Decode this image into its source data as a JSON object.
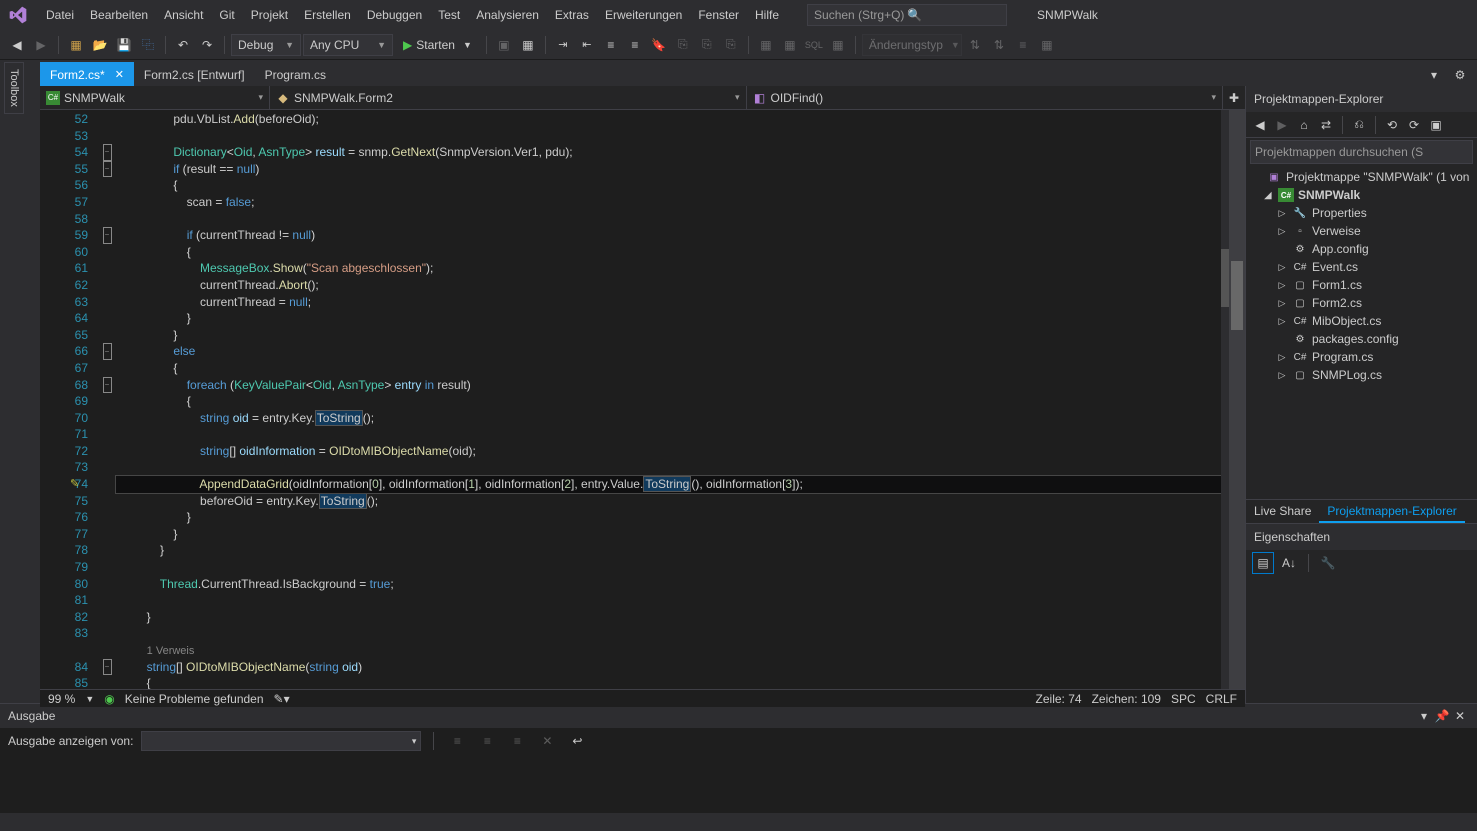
{
  "menubar": {
    "items": [
      "Datei",
      "Bearbeiten",
      "Ansicht",
      "Git",
      "Projekt",
      "Erstellen",
      "Debuggen",
      "Test",
      "Analysieren",
      "Extras",
      "Erweiterungen",
      "Fenster",
      "Hilfe"
    ]
  },
  "search": {
    "placeholder": "Suchen (Strg+Q)"
  },
  "solution_name": "SNMPWalk",
  "toolbar": {
    "config": "Debug",
    "platform": "Any CPU",
    "start": "Starten",
    "changes": "Änderungstyp"
  },
  "tabs": [
    {
      "label": "Form2.cs",
      "active": true,
      "dirty": true
    },
    {
      "label": "Form2.cs [Entwurf]",
      "active": false
    },
    {
      "label": "Program.cs",
      "active": false
    }
  ],
  "toolbox_label": "Toolbox",
  "navbar": {
    "project": "SNMPWalk",
    "class": "SNMPWalk.Form2",
    "member": "OIDFind()"
  },
  "code": {
    "first_line": 52,
    "lines": [
      {
        "n": 52,
        "html": "                pdu<span class='pl'>.</span>VbList<span class='pl'>.</span><span class='fn'>Add</span><span class='pl'>(</span>beforeOid<span class='pl'>);</span>"
      },
      {
        "n": 53,
        "html": ""
      },
      {
        "n": 54,
        "fold": "-",
        "html": "                <span class='type'>Dictionary</span><span class='pl'>&lt;</span><span class='type'>Oid</span><span class='pl'>, </span><span class='type'>AsnType</span><span class='pl'>&gt; </span><span class='var'>result</span><span class='pl'> = </span>snmp<span class='pl'>.</span><span class='fn'>GetNext</span><span class='pl'>(</span>SnmpVersion<span class='pl'>.</span>Ver1<span class='pl'>, </span>pdu<span class='pl'>);</span>"
      },
      {
        "n": 55,
        "fold": "-",
        "html": "                <span class='kw'>if</span><span class='pl'> (</span>result<span class='pl'> == </span><span class='kw'>null</span><span class='pl'>)</span>"
      },
      {
        "n": 56,
        "html": "                <span class='pl'>{</span>"
      },
      {
        "n": 57,
        "html": "                    scan<span class='pl'> = </span><span class='kw'>false</span><span class='pl'>;</span>"
      },
      {
        "n": 58,
        "html": ""
      },
      {
        "n": 59,
        "fold": "-",
        "html": "                    <span class='kw'>if</span><span class='pl'> (</span>currentThread<span class='pl'> != </span><span class='kw'>null</span><span class='pl'>)</span>"
      },
      {
        "n": 60,
        "html": "                    <span class='pl'>{</span>"
      },
      {
        "n": 61,
        "html": "                        <span class='type'>MessageBox</span><span class='pl'>.</span><span class='fn'>Show</span><span class='pl'>(</span><span class='str'>\"Scan abgeschlossen\"</span><span class='pl'>);</span>"
      },
      {
        "n": 62,
        "html": "                        currentThread<span class='pl'>.</span><span class='fn'>Abort</span><span class='pl'>();</span>"
      },
      {
        "n": 63,
        "html": "                        currentThread<span class='pl'> = </span><span class='kw'>null</span><span class='pl'>;</span>"
      },
      {
        "n": 64,
        "html": "                    <span class='pl'>}</span>"
      },
      {
        "n": 65,
        "html": "                <span class='pl'>}</span>"
      },
      {
        "n": 66,
        "fold": "-",
        "html": "                <span class='kw'>else</span>"
      },
      {
        "n": 67,
        "html": "                <span class='pl'>{</span>"
      },
      {
        "n": 68,
        "fold": "-",
        "html": "                    <span class='kw'>foreach</span><span class='pl'> (</span><span class='type'>KeyValuePair</span><span class='pl'>&lt;</span><span class='type'>Oid</span><span class='pl'>, </span><span class='type'>AsnType</span><span class='pl'>&gt; </span><span class='var'>entry</span><span class='pl'> </span><span class='kw'>in</span><span class='pl'> </span>result<span class='pl'>)</span>"
      },
      {
        "n": 69,
        "html": "                    <span class='pl'>{</span>"
      },
      {
        "n": 70,
        "html": "                        <span class='kw'>string</span><span class='pl'> </span><span class='var'>oid</span><span class='pl'> = </span>entry<span class='pl'>.</span>Key<span class='pl'>.</span><span class='hlbox'>ToString</span><span class='pl'>();</span>"
      },
      {
        "n": 71,
        "html": ""
      },
      {
        "n": 72,
        "html": "                        <span class='kw'>string</span><span class='pl'>[] </span><span class='var'>oidInformation</span><span class='pl'> = </span><span class='fn'>OIDtoMIBObjectName</span><span class='pl'>(</span>oid<span class='pl'>);</span>"
      },
      {
        "n": 73,
        "html": ""
      },
      {
        "n": 74,
        "hl": true,
        "glyph": "✎",
        "html": "                        <span class='fn'>AppendDataGrid</span><span class='pl'>(</span>oidInformation<span class='pl'>[</span><span class='num'>0</span><span class='pl'>], </span>oidInformation<span class='pl'>[</span><span class='num'>1</span><span class='pl'>], </span>oidInformation<span class='pl'>[</span><span class='num'>2</span><span class='pl'>], </span>entry<span class='pl'>.</span>Value<span class='pl'>.</span><span class='hlbox'>ToString</span><span class='pl'>(), </span>oidInformation<span class='pl'>[</span><span class='num'>3</span><span class='pl'>]);</span>"
      },
      {
        "n": 75,
        "html": "                        beforeOid<span class='pl'> = </span>entry<span class='pl'>.</span>Key<span class='pl'>.</span><span class='hlbox'>ToString</span><span class='pl'>();</span>"
      },
      {
        "n": 76,
        "html": "                    <span class='pl'>}</span>"
      },
      {
        "n": 77,
        "html": "                <span class='pl'>}</span>"
      },
      {
        "n": 78,
        "html": "            <span class='pl'>}</span>"
      },
      {
        "n": 79,
        "html": ""
      },
      {
        "n": 80,
        "html": "            <span class='type'>Thread</span><span class='pl'>.</span>CurrentThread<span class='pl'>.</span>IsBackground<span class='pl'> = </span><span class='kw'>true</span><span class='pl'>;</span>"
      },
      {
        "n": 81,
        "html": ""
      },
      {
        "n": 82,
        "html": "        <span class='pl'>}</span>"
      },
      {
        "n": 83,
        "html": ""
      },
      {
        "n": "",
        "codelens": true,
        "html": "        <span class='codelens'>1 Verweis</span>"
      },
      {
        "n": 84,
        "fold": "-",
        "html": "        <span class='kw'>string</span><span class='pl'>[] </span><span class='fn'>OIDtoMIBObjectName</span><span class='pl'>(</span><span class='kw'>string</span><span class='pl'> </span><span class='var'>oid</span><span class='pl'>)</span>"
      },
      {
        "n": 85,
        "html": "        <span class='pl'>{</span>"
      }
    ]
  },
  "status": {
    "zoom": "99 %",
    "problems": "Keine Probleme gefunden",
    "line": "Zeile: 74",
    "col": "Zeichen: 109",
    "ins": "SPC",
    "eol": "CRLF"
  },
  "explorer": {
    "title": "Projektmappen-Explorer",
    "search": "Projektmappen durchsuchen (S",
    "solution": "Projektmappe \"SNMPWalk\" (1 von",
    "project": "SNMPWalk",
    "items": [
      {
        "label": "Properties",
        "icon": "🔧",
        "exp": "▷"
      },
      {
        "label": "Verweise",
        "icon": "▫",
        "exp": "▷"
      },
      {
        "label": "App.config",
        "icon": "⚙",
        "exp": ""
      },
      {
        "label": "Event.cs",
        "icon": "C#",
        "exp": "▷"
      },
      {
        "label": "Form1.cs",
        "icon": "▢",
        "exp": "▷"
      },
      {
        "label": "Form2.cs",
        "icon": "▢",
        "exp": "▷"
      },
      {
        "label": "MibObject.cs",
        "icon": "C#",
        "exp": "▷"
      },
      {
        "label": "packages.config",
        "icon": "⚙",
        "exp": ""
      },
      {
        "label": "Program.cs",
        "icon": "C#",
        "exp": "▷"
      },
      {
        "label": "SNMPLog.cs",
        "icon": "▢",
        "exp": "▷"
      }
    ],
    "bottom_tabs": [
      "Live Share",
      "Projektmappen-Explorer"
    ]
  },
  "properties": {
    "title": "Eigenschaften"
  },
  "output": {
    "title": "Ausgabe",
    "show_from": "Ausgabe anzeigen von:"
  }
}
